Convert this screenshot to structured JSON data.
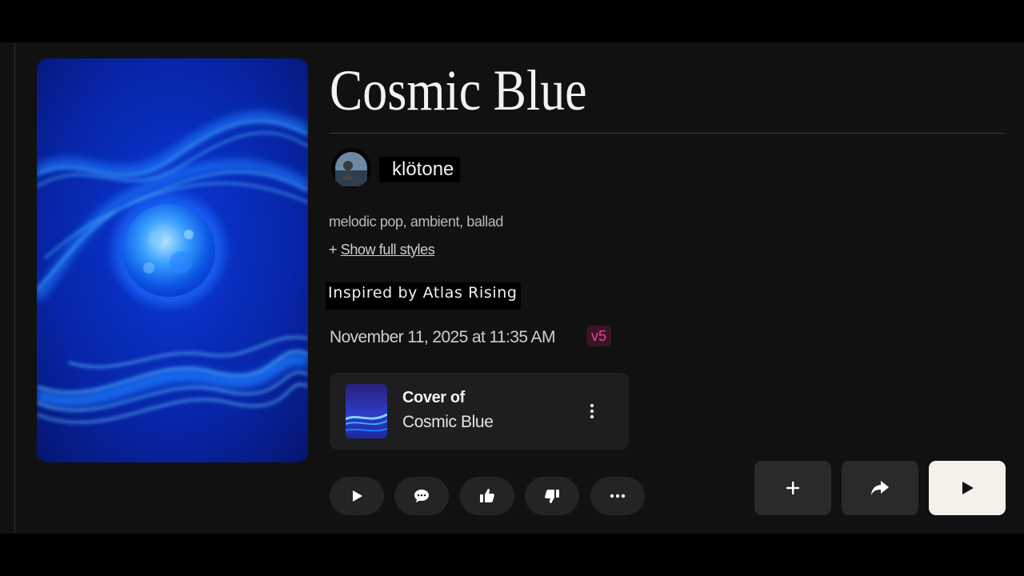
{
  "song": {
    "title": "Cosmic Blue",
    "artist": "klötone",
    "styles": "melodic pop, ambient, ballad",
    "show_styles_prefix": "+ ",
    "show_styles_link": "Show full styles",
    "description": "Inspired by Atlas Rising",
    "date": "November 11, 2025 at 11:35 AM",
    "version_badge": "v5"
  },
  "cover_card": {
    "label": "Cover of",
    "title": "Cosmic Blue"
  },
  "icons": {
    "actions": [
      "play-icon",
      "comment-icon",
      "thumbs-up-icon",
      "thumbs-down-icon",
      "more-icon"
    ],
    "primary": [
      "plus-icon",
      "share-icon",
      "play-icon"
    ]
  },
  "colors": {
    "background": "#111112",
    "cover_blue": "#0a4cff",
    "version_badge_text": "#e2458d",
    "primary_button": "#f4f1ea"
  }
}
